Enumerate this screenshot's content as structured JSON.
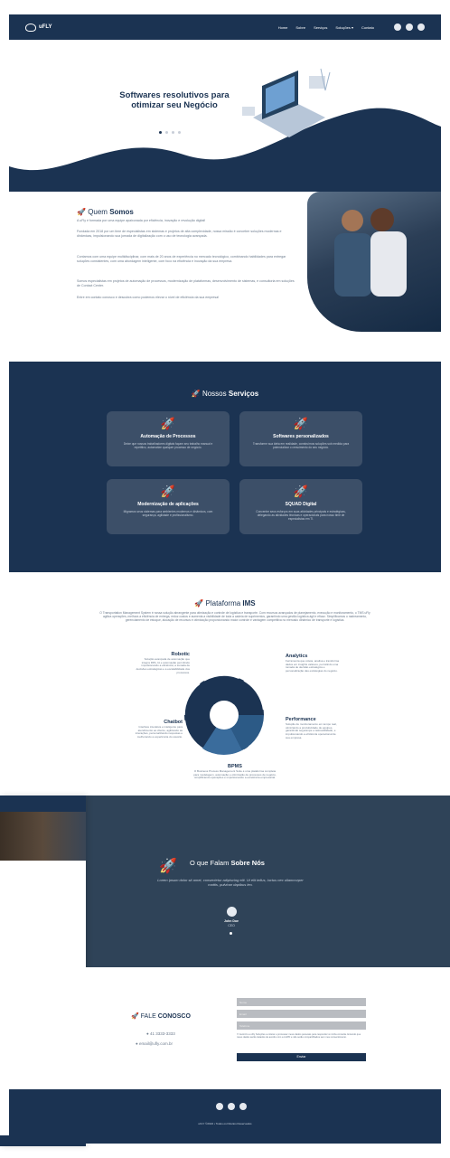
{
  "brand": {
    "name": "uFLY"
  },
  "nav": {
    "items": [
      "Home",
      "Sobre",
      "Serviços",
      "Soluções ▾",
      "Contato"
    ]
  },
  "hero": {
    "title": "Softwares resolutivos para otimizar seu Negócio"
  },
  "about": {
    "title_a": "Quem ",
    "title_b": "Somos",
    "p1": "A uFly é formada por uma equipe apaixonada por eficiência, inovação e revolução digital!",
    "p2": "Fundada em 2018 por um time de especialistas em sistemas e projetos de alta complexidade, nossa missão é conceber soluções modernas e dinâmicas, impulsionando sua jornada de digitalização com o uso de tecnologia avançada.",
    "p3": "Contamos com uma equipe multidisciplinar, com mais de 20 anos de experiência no mercado tecnológico, combinando habilidades para entregar soluções consistentes, com uma abordagem inteligente, com foco na eficiência e inovação da sua empresa.",
    "p4": "Somos especialistas em projetos de automação de processos, modernização de plataformas, desenvolvimento de sistemas, e consultoria em soluções de Contact Center.",
    "p5": "Entre em contato conosco e descubra como podemos elevar o nível de eficiência da sua empresa!"
  },
  "services": {
    "title_a": "Nossos ",
    "title_b": "Serviços",
    "cards": [
      {
        "title": "Automação de Processos",
        "text": "Deixe que nossos trabalhadores digitais façam seu trabalho manual e repetitivo, automatize qualquer processo de negócio."
      },
      {
        "title": "Softwares personalizados",
        "text": "Transforme sua ideia em realidade, construímos soluções sob medida para potencializar o crescimento do seu negócio."
      },
      {
        "title": "Modernização de aplicações",
        "text": "Migramos seus sistemas para ambientes modernos e dinâmicos, com segurança, agilidade e profissionalismo."
      },
      {
        "title": "SQUAD Digital",
        "text": "Concentre seus esforços em suas atividades principais e estratégicas, delegando as atividades técnicas e operacionais para nosso time de especialistas em TI."
      }
    ]
  },
  "ims": {
    "title_a": "Plataforma ",
    "title_b": "IMS",
    "lead": "O Transportation Management System é nossa solução abrangente para otimização e controle de logística e transporte. Com recursos avançados de planejamento, execução e monitoramento, o TMS uFly agiliza operações, melhora a eficiência de entrega, reduz custos e aumenta a visibilidade de toda a cadeia de suprimentos, garantindo uma gestão logística ágil e eficaz. Simplificamos o rastreamento, gerenciamento de estoque, alocação de recursos e otimização proporcionando maior controle e vantagem competitiva no mercado dinâmico de transporte e logística.",
    "features": [
      {
        "name": "Robotic",
        "text": "Solução avançada de automação que integra RPA, IA e automação permitindo impulsionando a eficiência, a tomada de decisões estratégicas e a escalabilidade dos processos."
      },
      {
        "name": "Analytics",
        "text": "Ferramenta que coleta, analisa e transforma dados em insights valiosos, permitindo uma tomada de decisão estratégica e personalização das estratégias do negócio."
      },
      {
        "name": "Chatbot",
        "text": "Interface interativa e inteligente para atendimento ao cliente, agilizando as interações, personalizando respostas e melhorando a experiência do usuário."
      },
      {
        "name": "Performance",
        "text": "Solução de monitoramento em tempo real, otimizando a produtividade de equipes, garantindo segurança e rastreabilidade, e impulsionando a eficiência operacional de sua empresa."
      },
      {
        "name": "BPMS",
        "text": "O Business Process Management Suite é uma plataforma completa para modelagem, automação e otimização de processos de negócio, simplificando operações e impulsionando a excelência empresarial."
      }
    ]
  },
  "testimonials": {
    "title_a": "O que Falam ",
    "title_b": "Sobre Nós",
    "quote": "Lorem ipsum dolor sit amet, consectetur adipiscing elit. Ut elit tellus, luctus nec ullamcorper mattis, pulvinar dapibus leo.",
    "name": "John Doe",
    "role": "CEO"
  },
  "contact": {
    "title_a": "FALE ",
    "title_b": "CONOSCO",
    "phone": "41 3333-3333",
    "email": "email@ufly.com.br",
    "fields": {
      "name": "Nome",
      "email": "Email",
      "phone": "Telefone"
    },
    "consent": "Autorizo a uFly Soluções a coletar e processar meus dados pessoais para responder à minha consulta. Entendo que meus dados serão tratados de acordo com a LGPD e não serão compartilhados sem meu consentimento.",
    "submit": "Enviar"
  },
  "footer": {
    "copyright": "uFLY ©2024 • Todos os Direitos Reservados"
  },
  "colors": {
    "navy": "#1b3352",
    "slate": "#2f4358",
    "card": "#3c4f68"
  }
}
